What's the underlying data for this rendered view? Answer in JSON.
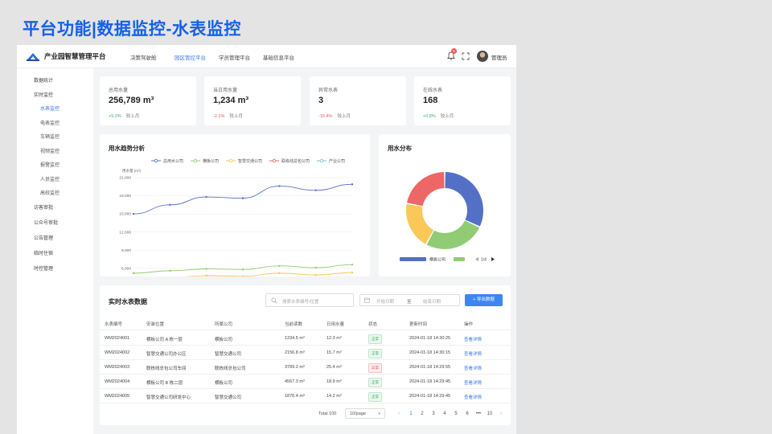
{
  "slide_title": "平台功能|数据监控-水表监控",
  "header": {
    "brand": "产业园智慧管理平台",
    "nav": [
      "决策驾驶舱",
      "园区管控平台",
      "学员管理平台",
      "基础信息平台"
    ],
    "active_nav": "园区管控平台",
    "notification_count": "5",
    "user_name": "管理员"
  },
  "sidebar": {
    "items": [
      "数据统计",
      "实时监控",
      "水表监控",
      "电表监控",
      "车辆监控",
      "视频监控",
      "报警监控",
      "人员监控",
      "高校监控",
      "访客审批",
      "公众号审批",
      "公告管理",
      "临时住宿",
      "时控管理"
    ],
    "active": "水表监控"
  },
  "stats": [
    {
      "label": "总用水量",
      "value": "256,789 m³",
      "change": "+5.2%",
      "compare": "较上月",
      "trend": "up"
    },
    {
      "label": "当日用水量",
      "value": "1,234 m³",
      "change": "-2.1%",
      "compare": "较上月",
      "trend": "down"
    },
    {
      "label": "异常水表",
      "value": "3",
      "change": "-15.4%",
      "compare": "较上月",
      "trend": "down"
    },
    {
      "label": "在线水表",
      "value": "168",
      "change": "+0.8%",
      "compare": "较上月",
      "trend": "up"
    }
  ],
  "chart_data": [
    {
      "type": "line",
      "title": "用水趋势分析",
      "ylabel": "用水量 (m³)",
      "categories": [
        "1月",
        "2月",
        "3月",
        "4月",
        "5月",
        "6月",
        "7月"
      ],
      "yticks": [
        "0",
        "3,000",
        "6,000",
        "9,000",
        "12,000",
        "15,000",
        "18,000",
        "21,000"
      ],
      "ylim": [
        0,
        21000
      ],
      "legend_position": "top",
      "series": [
        {
          "name": "总用水公司",
          "color": "#5470c6",
          "values": [
            15000,
            16500,
            17800,
            17600,
            19600,
            18900,
            19900
          ]
        },
        {
          "name": "横板公司",
          "color": "#91cc75",
          "values": [
            5200,
            5600,
            5900,
            5800,
            6400,
            6100,
            6600
          ]
        },
        {
          "name": "智慧交通公司",
          "color": "#fac858",
          "values": [
            4200,
            4500,
            4800,
            4700,
            5200,
            4900,
            5300
          ]
        },
        {
          "name": "联栋线总包公司",
          "color": "#ee6666",
          "values": [
            3300,
            3600,
            3800,
            3700,
            4100,
            3900,
            4300
          ]
        },
        {
          "name": "产业公司",
          "color": "#73c0de",
          "values": [
            2600,
            2800,
            3000,
            2900,
            3200,
            3100,
            3300
          ]
        }
      ]
    },
    {
      "type": "pie",
      "title": "用水分布",
      "legend_label": "横板公司",
      "legend_page": "1/4",
      "slices": [
        {
          "name": "横板公司",
          "color": "#5470c6",
          "value": 32
        },
        {
          "name": "智慧交通公司",
          "color": "#91cc75",
          "value": 26
        },
        {
          "name": "联栋线总包公司",
          "color": "#fac858",
          "value": 20
        },
        {
          "name": "产业公司",
          "color": "#ee6666",
          "value": 22
        }
      ]
    }
  ],
  "table": {
    "title": "实时水表数据",
    "search_placeholder": "搜索水表编号/位置",
    "date_start": "开始日期",
    "date_sep": "至",
    "date_end": "结束日期",
    "export_label": "+ 导出数据",
    "columns": [
      "水表编号",
      "安装位置",
      "所属公司",
      "当前读数",
      "日用水量",
      "状态",
      "更新时间",
      "操作"
    ],
    "rows": [
      {
        "id": "WM2024001",
        "location": "横板公司 A 栋一层",
        "company": "横板公司",
        "reading": "1234.5 m³",
        "daily": "12.3 m³",
        "status": "正常",
        "status_type": "ok",
        "time": "2024-01-18 14:30:25",
        "action": "查看详情"
      },
      {
        "id": "WM2024002",
        "location": "智慧交通公司办公区",
        "company": "智慧交通公司",
        "reading": "2156.8 m³",
        "daily": "15.7 m³",
        "status": "正常",
        "status_type": "ok",
        "time": "2024-01-18 14:30:15",
        "action": "查看详情"
      },
      {
        "id": "WM2024003",
        "location": "联栋线总包公司车间",
        "company": "联栋线总包公司",
        "reading": "3789.2 m³",
        "daily": "25.4 m³",
        "status": "异常",
        "status_type": "bad",
        "time": "2024-01-18 14:29:55",
        "action": "查看详情"
      },
      {
        "id": "WM2024004",
        "location": "横板公司 B 栋二层",
        "company": "横板公司",
        "reading": "4567.3 m³",
        "daily": "18.9 m³",
        "status": "正常",
        "status_type": "ok",
        "time": "2024-01-18 14:29:45",
        "action": "查看详情"
      },
      {
        "id": "WM2024005",
        "location": "智慧交通公司研发中心",
        "company": "智慧交通公司",
        "reading": "1876.4 m³",
        "daily": "14.2 m³",
        "status": "正常",
        "status_type": "ok",
        "time": "2024-01-18 14:29:45",
        "action": "查看详情"
      }
    ],
    "pagination": {
      "total": "Total 100",
      "page_size": "10/page",
      "pages": [
        "1",
        "2",
        "3",
        "4",
        "5",
        "6",
        "•••",
        "10"
      ],
      "current": "1",
      "prev": "‹",
      "next": "›"
    }
  }
}
